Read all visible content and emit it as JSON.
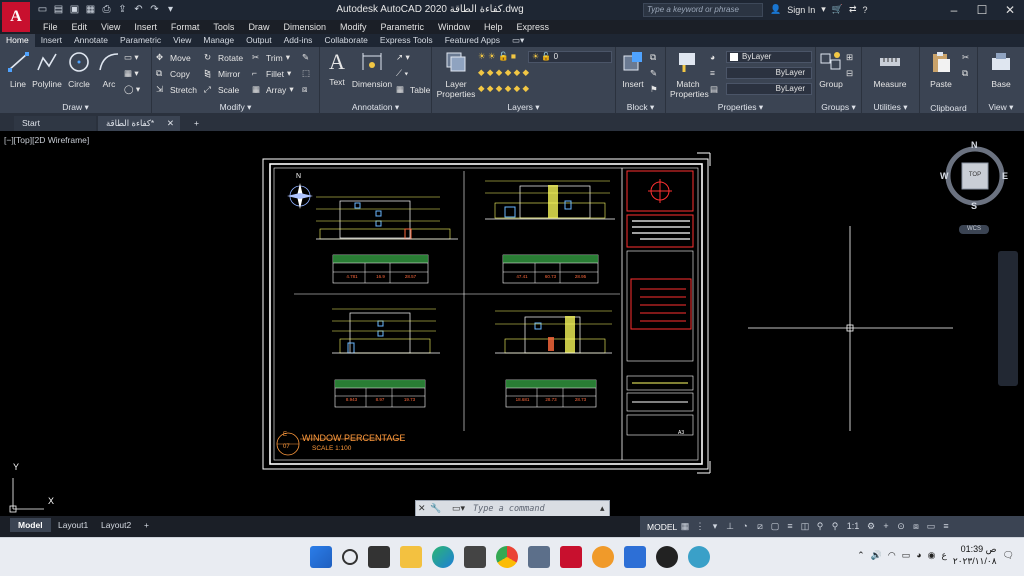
{
  "app": {
    "logo": "A",
    "title": "Autodesk AutoCAD 2020  كفاءة الطاقة.dwg",
    "search_placeholder": "Type a keyword or phrase",
    "sign_in": "Sign In",
    "help": "?"
  },
  "menu": [
    "File",
    "Edit",
    "View",
    "Insert",
    "Format",
    "Tools",
    "Draw",
    "Dimension",
    "Modify",
    "Parametric",
    "Window",
    "Help",
    "Express"
  ],
  "ribbon_tabs": [
    "Home",
    "Insert",
    "Annotate",
    "Parametric",
    "View",
    "Manage",
    "Output",
    "Add-ins",
    "Collaborate",
    "Express Tools",
    "Featured Apps"
  ],
  "ribbon": {
    "draw": {
      "title": "Draw",
      "line": "Line",
      "polyline": "Polyline",
      "circle": "Circle",
      "arc": "Arc"
    },
    "modify": {
      "title": "Modify",
      "move": "Move",
      "rotate": "Rotate",
      "trim": "Trim",
      "copy": "Copy",
      "mirror": "Mirror",
      "fillet": "Fillet",
      "stretch": "Stretch",
      "scale": "Scale",
      "array": "Array"
    },
    "annotation": {
      "title": "Annotation",
      "text": "Text",
      "dimension": "Dimension",
      "table": "Table"
    },
    "layers": {
      "title": "Layers",
      "layer_properties": "Layer Properties",
      "current_layer": "0"
    },
    "block": {
      "title": "Block",
      "insert": "Insert"
    },
    "properties": {
      "title": "Properties",
      "match": "Match Properties",
      "color": "ByLayer",
      "linetype": "ByLayer",
      "lineweight": "ByLayer"
    },
    "groups": {
      "title": "Groups",
      "group": "Group"
    },
    "utilities": {
      "title": "Utilities",
      "measure": "Measure"
    },
    "clipboard": {
      "title": "Clipboard",
      "paste": "Paste"
    },
    "view": {
      "title": "View",
      "base": "Base"
    }
  },
  "file_tabs": {
    "start": "Start",
    "active": "كفاءة الطاقة*"
  },
  "viewport": {
    "label": "[−][Top][2D Wireframe]",
    "viewcube": {
      "top": "TOP",
      "n": "N",
      "s": "S",
      "e": "E",
      "w": "W",
      "wcs": "WCS"
    },
    "sheet": {
      "title": "WINDOW PERCENTAGE",
      "scale": "SCALE 1:100",
      "number": "E",
      "number_sub": "07",
      "north": "N",
      "tables": [
        {
          "cells": [
            "4.781",
            "16.9",
            "28.57"
          ]
        },
        {
          "cells": [
            "47.41",
            "60.73",
            "28.95"
          ]
        },
        {
          "cells": [
            "8.943",
            "8.97",
            "19.73"
          ]
        },
        {
          "cells": [
            "18.681",
            "28.73",
            "28.73"
          ]
        }
      ],
      "sheet_code": "A3"
    },
    "ucs": {
      "x": "X",
      "y": "Y"
    }
  },
  "layout_tabs": [
    "Model",
    "Layout1",
    "Layout2"
  ],
  "status": {
    "model": "MODEL",
    "scale": "1:1"
  },
  "command": {
    "placeholder": "Type a command"
  },
  "taskbar": {
    "time": "01:39 ص",
    "date": "٢٠٢٣/١١/٠٨",
    "lang": "ع"
  }
}
